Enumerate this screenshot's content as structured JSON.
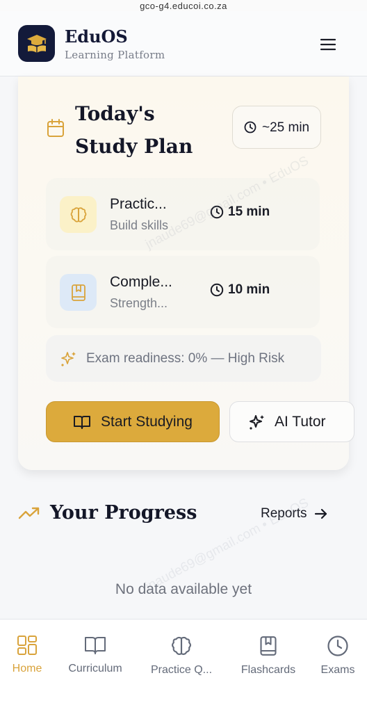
{
  "browser": {
    "url_fragment": "gco-g4.educoi.co.za"
  },
  "header": {
    "brand_title": "EduOS",
    "brand_subtitle": "Learning Platform",
    "logo_icon": "graduation-book-icon",
    "menu_icon": "hamburger-icon"
  },
  "study_plan": {
    "title": "Today's Study Plan",
    "total_time": "~25 min",
    "tasks": [
      {
        "name": "Practic...",
        "subtitle": "Build skills",
        "duration": "15 min",
        "icon": "brain-icon",
        "icon_bg": "#fbf1c8",
        "icon_color": "#d9a33b"
      },
      {
        "name": "Comple...",
        "subtitle": "Strength...",
        "duration": "10 min",
        "icon": "bookmark-book-icon",
        "icon_bg": "#dde9f7",
        "icon_color": "#d9a33b"
      }
    ],
    "readiness_text": "Exam readiness: 0% — High Risk",
    "start_button": "Start Studying",
    "tutor_button": "AI Tutor"
  },
  "progress": {
    "title": "Your Progress",
    "reports_link": "Reports",
    "empty_text": "No data available yet"
  },
  "bottom_nav": [
    {
      "label": "Home",
      "icon": "grid-icon",
      "active": true
    },
    {
      "label": "Curriculum",
      "icon": "open-book-icon",
      "active": false
    },
    {
      "label": "Practice Q...",
      "icon": "brain-icon",
      "active": false
    },
    {
      "label": "Flashcards",
      "icon": "bookmark-book-icon",
      "active": false
    },
    {
      "label": "Exams",
      "icon": "clock-icon",
      "active": false
    }
  ],
  "watermark": "jnaude69@gmail.com • EduOS",
  "colors": {
    "accent": "#d9a33b",
    "button_gold": "#dcaa3c",
    "navy": "#131a3a",
    "text_dark": "#141728",
    "text_muted": "#6e7380"
  }
}
